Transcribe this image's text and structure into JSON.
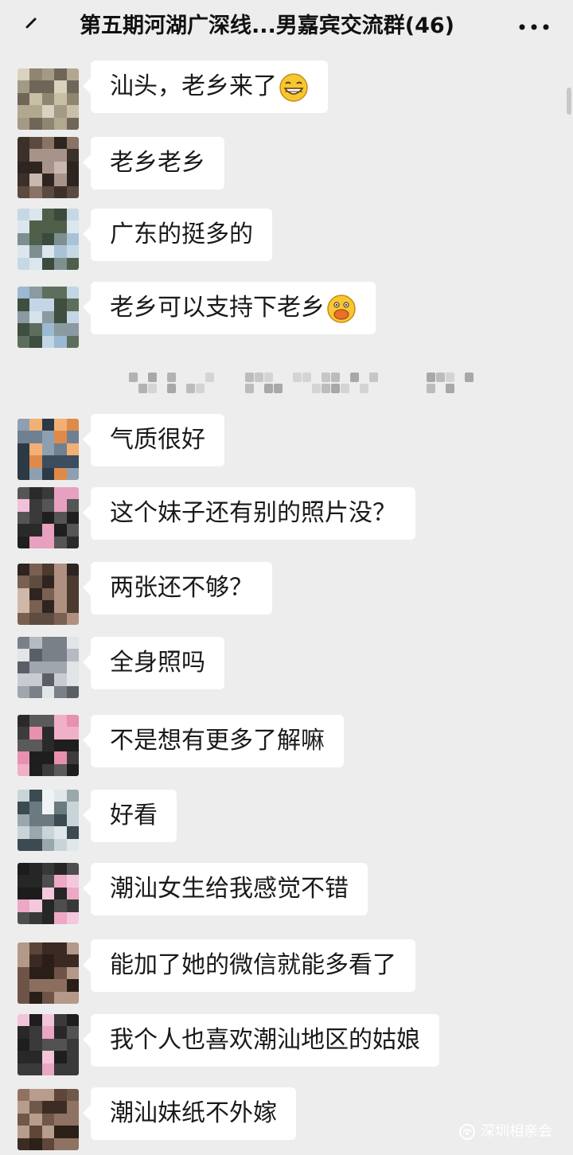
{
  "header": {
    "title": "第五期河湖广深线...男嘉宾交流群(46)",
    "back_icon": "back-arrow-icon",
    "more_icon": "more-dots-icon"
  },
  "messages": [
    {
      "text": "汕头，老乡来了",
      "emoji": "grinning-face-icon"
    },
    {
      "text": "老乡老乡"
    },
    {
      "text": "广东的挺多的"
    },
    {
      "text": "老乡可以支持下老乡",
      "emoji": "hand-over-mouth-face-icon"
    },
    {
      "text": "气质很好"
    },
    {
      "text": "这个妹子还有别的照片没？"
    },
    {
      "text": "两张还不够？"
    },
    {
      "text": "全身照吗"
    },
    {
      "text": "不是想有更多了解嘛"
    },
    {
      "text": "好看"
    },
    {
      "text": "潮汕女生给我感觉不错"
    },
    {
      "text": "能加了她的微信就能多看了"
    },
    {
      "text": "我个人也喜欢潮汕地区的姑娘"
    },
    {
      "text": "潮汕妹纸不外嫁"
    }
  ],
  "watermark": {
    "text": "深圳相亲会",
    "icon": "wechat-official-account-icon"
  },
  "colors": {
    "background": "#ededed",
    "bubble": "#ffffff",
    "text": "#1a1a1a"
  }
}
